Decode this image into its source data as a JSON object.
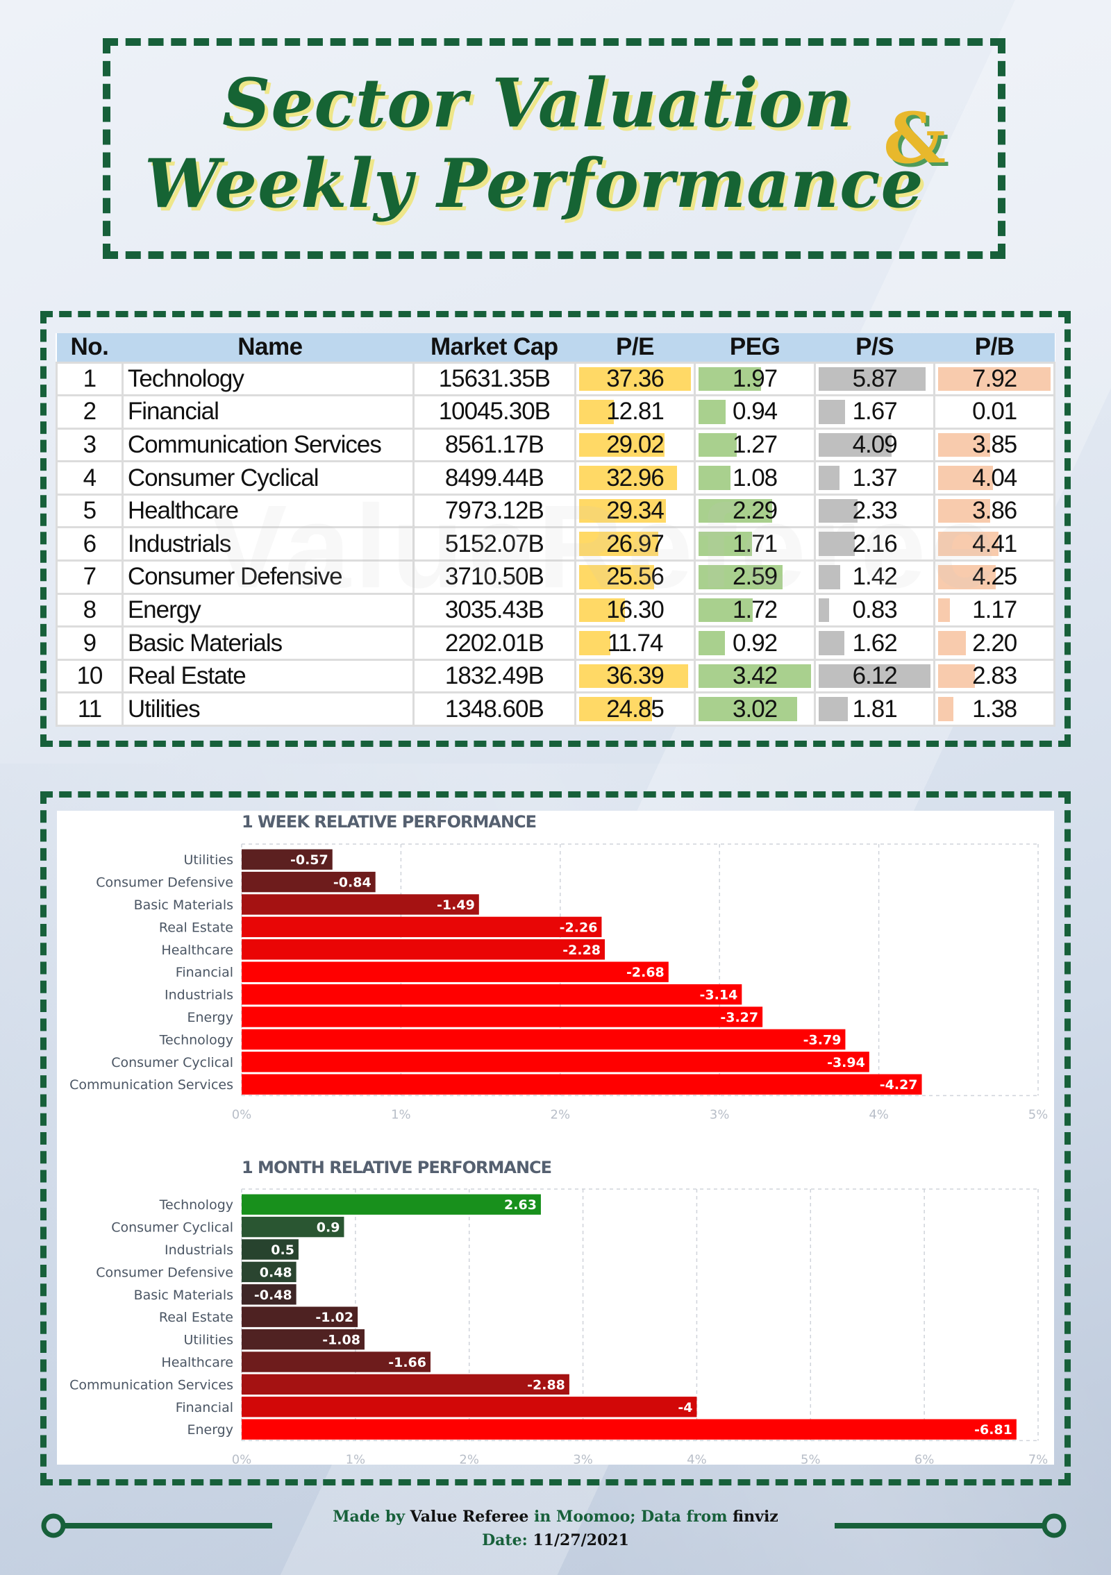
{
  "title": {
    "line1": "Sector Valuation",
    "ampersand": "&",
    "line2": "Weekly Performance"
  },
  "watermark": "ValueReferee",
  "colors": {
    "frame": "#17603a",
    "header_bg": "#bdd7ee",
    "pe_bar": "#ffd966",
    "peg_bar": "#a9d08e",
    "ps_bar": "#bfbfbf",
    "pb_bar": "#f8cbad"
  },
  "table": {
    "columns": [
      "No.",
      "Name",
      "Market Cap",
      "P/E",
      "PEG",
      "P/S",
      "P/B"
    ],
    "rows": [
      {
        "no": "1",
        "name": "Technology",
        "market_cap": "15631.35B",
        "pe": "37.36",
        "peg": "1.97",
        "ps": "5.87",
        "pb": "7.92"
      },
      {
        "no": "2",
        "name": "Financial",
        "market_cap": "10045.30B",
        "pe": "12.81",
        "peg": "0.94",
        "ps": "1.67",
        "pb": "0.01"
      },
      {
        "no": "3",
        "name": "Communication Services",
        "market_cap": "8561.17B",
        "pe": "29.02",
        "peg": "1.27",
        "ps": "4.09",
        "pb": "3.85"
      },
      {
        "no": "4",
        "name": "Consumer Cyclical",
        "market_cap": "8499.44B",
        "pe": "32.96",
        "peg": "1.08",
        "ps": "1.37",
        "pb": "4.04"
      },
      {
        "no": "5",
        "name": "Healthcare",
        "market_cap": "7973.12B",
        "pe": "29.34",
        "peg": "2.29",
        "ps": "2.33",
        "pb": "3.86"
      },
      {
        "no": "6",
        "name": "Industrials",
        "market_cap": "5152.07B",
        "pe": "26.97",
        "peg": "1.71",
        "ps": "2.16",
        "pb": "4.41"
      },
      {
        "no": "7",
        "name": "Consumer Defensive",
        "market_cap": "3710.50B",
        "pe": "25.56",
        "peg": "2.59",
        "ps": "1.42",
        "pb": "4.25"
      },
      {
        "no": "8",
        "name": "Energy",
        "market_cap": "3035.43B",
        "pe": "16.30",
        "peg": "1.72",
        "ps": "0.83",
        "pb": "1.17"
      },
      {
        "no": "9",
        "name": "Basic Materials",
        "market_cap": "2202.01B",
        "pe": "11.74",
        "peg": "0.92",
        "ps": "1.62",
        "pb": "2.20"
      },
      {
        "no": "10",
        "name": "Real Estate",
        "market_cap": "1832.49B",
        "pe": "36.39",
        "peg": "3.42",
        "ps": "6.12",
        "pb": "2.83"
      },
      {
        "no": "11",
        "name": "Utilities",
        "market_cap": "1348.60B",
        "pe": "24.85",
        "peg": "3.02",
        "ps": "1.81",
        "pb": "1.38"
      }
    ]
  },
  "chart_data": [
    {
      "type": "bar",
      "orientation": "horizontal",
      "title": "1 WEEK RELATIVE PERFORMANCE",
      "categories": [
        "Utilities",
        "Consumer Defensive",
        "Basic Materials",
        "Real Estate",
        "Healthcare",
        "Financial",
        "Industrials",
        "Energy",
        "Technology",
        "Consumer Cyclical",
        "Communication Services"
      ],
      "values": [
        -0.57,
        -0.84,
        -1.49,
        -2.26,
        -2.28,
        -2.68,
        -3.14,
        -3.27,
        -3.79,
        -3.94,
        -4.27
      ],
      "bar_colors": [
        "#5c2020",
        "#6e1c1c",
        "#a51212",
        "#e80606",
        "#ea0505",
        "#ff0000",
        "#ff0000",
        "#ff0000",
        "#ff0000",
        "#ff0000",
        "#ff0000"
      ],
      "xlabel": "",
      "ylabel": "",
      "xlim": [
        0,
        5
      ],
      "x_ticks": [
        "0%",
        "1%",
        "2%",
        "3%",
        "4%",
        "5%"
      ],
      "value_scale": "absolute",
      "grid": true,
      "legend": "none"
    },
    {
      "type": "bar",
      "orientation": "horizontal",
      "title": "1 MONTH RELATIVE PERFORMANCE",
      "categories": [
        "Technology",
        "Consumer Cyclical",
        "Industrials",
        "Consumer Defensive",
        "Basic Materials",
        "Real Estate",
        "Utilities",
        "Healthcare",
        "Communication Services",
        "Financial",
        "Energy"
      ],
      "values": [
        2.63,
        0.9,
        0.5,
        0.48,
        -0.48,
        -1.02,
        -1.08,
        -1.66,
        -2.88,
        -4,
        -6.81
      ],
      "labels": [
        "2.63",
        "0.9",
        "0.5",
        "0.48",
        "-0.48",
        "-1.02",
        "-1.08",
        "-1.66",
        "-2.88",
        "-4",
        "-6.81"
      ],
      "bar_colors": [
        "#18901c",
        "#2a5632",
        "#27432e",
        "#2a4530",
        "#3e2626",
        "#4e2222",
        "#502222",
        "#6e1c1c",
        "#a51212",
        "#d20808",
        "#ff0000"
      ],
      "xlabel": "",
      "ylabel": "",
      "xlim": [
        0,
        7
      ],
      "x_ticks": [
        "0%",
        "1%",
        "2%",
        "3%",
        "4%",
        "5%",
        "6%",
        "7%"
      ],
      "value_scale": "absolute",
      "grid": true,
      "legend": "none"
    }
  ],
  "footer": {
    "made_by_prefix": "Made by ",
    "author": "Value Referee",
    "in_platform": " in Moomoo; Data from ",
    "source": "finviz",
    "date_label": "Date: ",
    "date": "11/27/2021"
  }
}
